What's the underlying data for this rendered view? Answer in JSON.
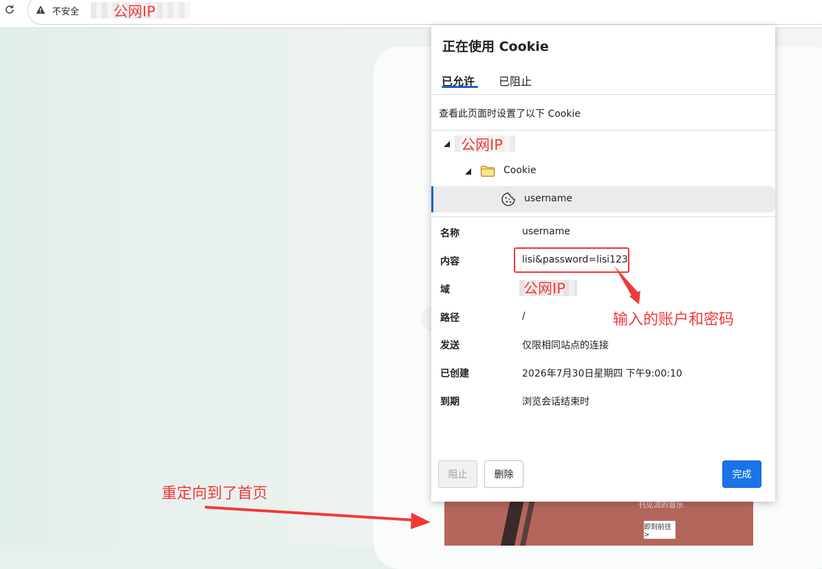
{
  "addressbar": {
    "security_label": "不安全",
    "host_text": "公网IP"
  },
  "background_page": {
    "banner_text": "刊见流的音乐",
    "banner_button": "即刻前往 >"
  },
  "dialog": {
    "title": "正在使用 Cookie",
    "tabs": [
      {
        "label": "已允许",
        "active": true
      },
      {
        "label": "已阻止",
        "active": false
      }
    ],
    "description": "查看此页面时设置了以下 Cookie",
    "tree": {
      "site": "公网IP",
      "folder": "Cookie",
      "cookie": "username"
    },
    "properties": [
      {
        "label": "名称",
        "value": "username"
      },
      {
        "label": "内容",
        "value": "lisi&password=lisi123"
      },
      {
        "label": "域",
        "value": "公网IP"
      },
      {
        "label": "路径",
        "value": "/"
      },
      {
        "label": "发送",
        "value": "仅限相同站点的连接"
      },
      {
        "label": "已创建",
        "value": "2026年7月30日星期四 下午9:00:10"
      },
      {
        "label": "到期",
        "value": "浏览会话结束时"
      }
    ],
    "buttons": {
      "block": "阻止",
      "delete": "删除",
      "done": "完成"
    }
  },
  "annotations": {
    "content_note": "输入的账户和密码",
    "redirect_note": "重定向到了首页",
    "color": "#f03a3a"
  },
  "colors": {
    "accent": "#1a73e8",
    "tab_underline": "#1a5fd1"
  }
}
